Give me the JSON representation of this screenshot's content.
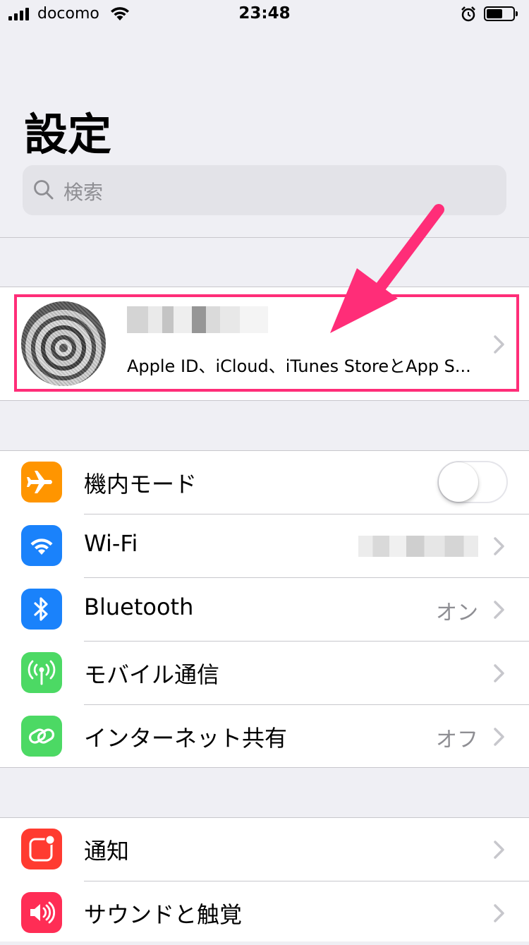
{
  "status_bar": {
    "carrier": "docomo",
    "time": "23:48"
  },
  "page": {
    "title": "設定"
  },
  "search": {
    "placeholder": "検索"
  },
  "profile": {
    "subtitle": "Apple ID、iCloud、iTunes StoreとApp S..."
  },
  "group1": [
    {
      "label": "機内モード",
      "icon": "airplane-icon",
      "color": "#ff9500",
      "toggle_on": false
    },
    {
      "label": "Wi-Fi",
      "icon": "wifi-icon",
      "color": "#1a82fb"
    },
    {
      "label": "Bluetooth",
      "icon": "bluetooth-icon",
      "color": "#1a82fb",
      "value": "オン"
    },
    {
      "label": "モバイル通信",
      "icon": "antenna-icon",
      "color": "#4cd964"
    },
    {
      "label": "インターネット共有",
      "icon": "hotspot-icon",
      "color": "#4cd964",
      "value": "オフ"
    }
  ],
  "group2": [
    {
      "label": "通知",
      "icon": "notifications-icon",
      "color": "#ff3b30"
    },
    {
      "label": "サウンドと触覚",
      "icon": "speaker-icon",
      "color": "#ff2d55"
    }
  ],
  "colors": {
    "highlight": "#ff2d78",
    "background": "#efeff4"
  }
}
